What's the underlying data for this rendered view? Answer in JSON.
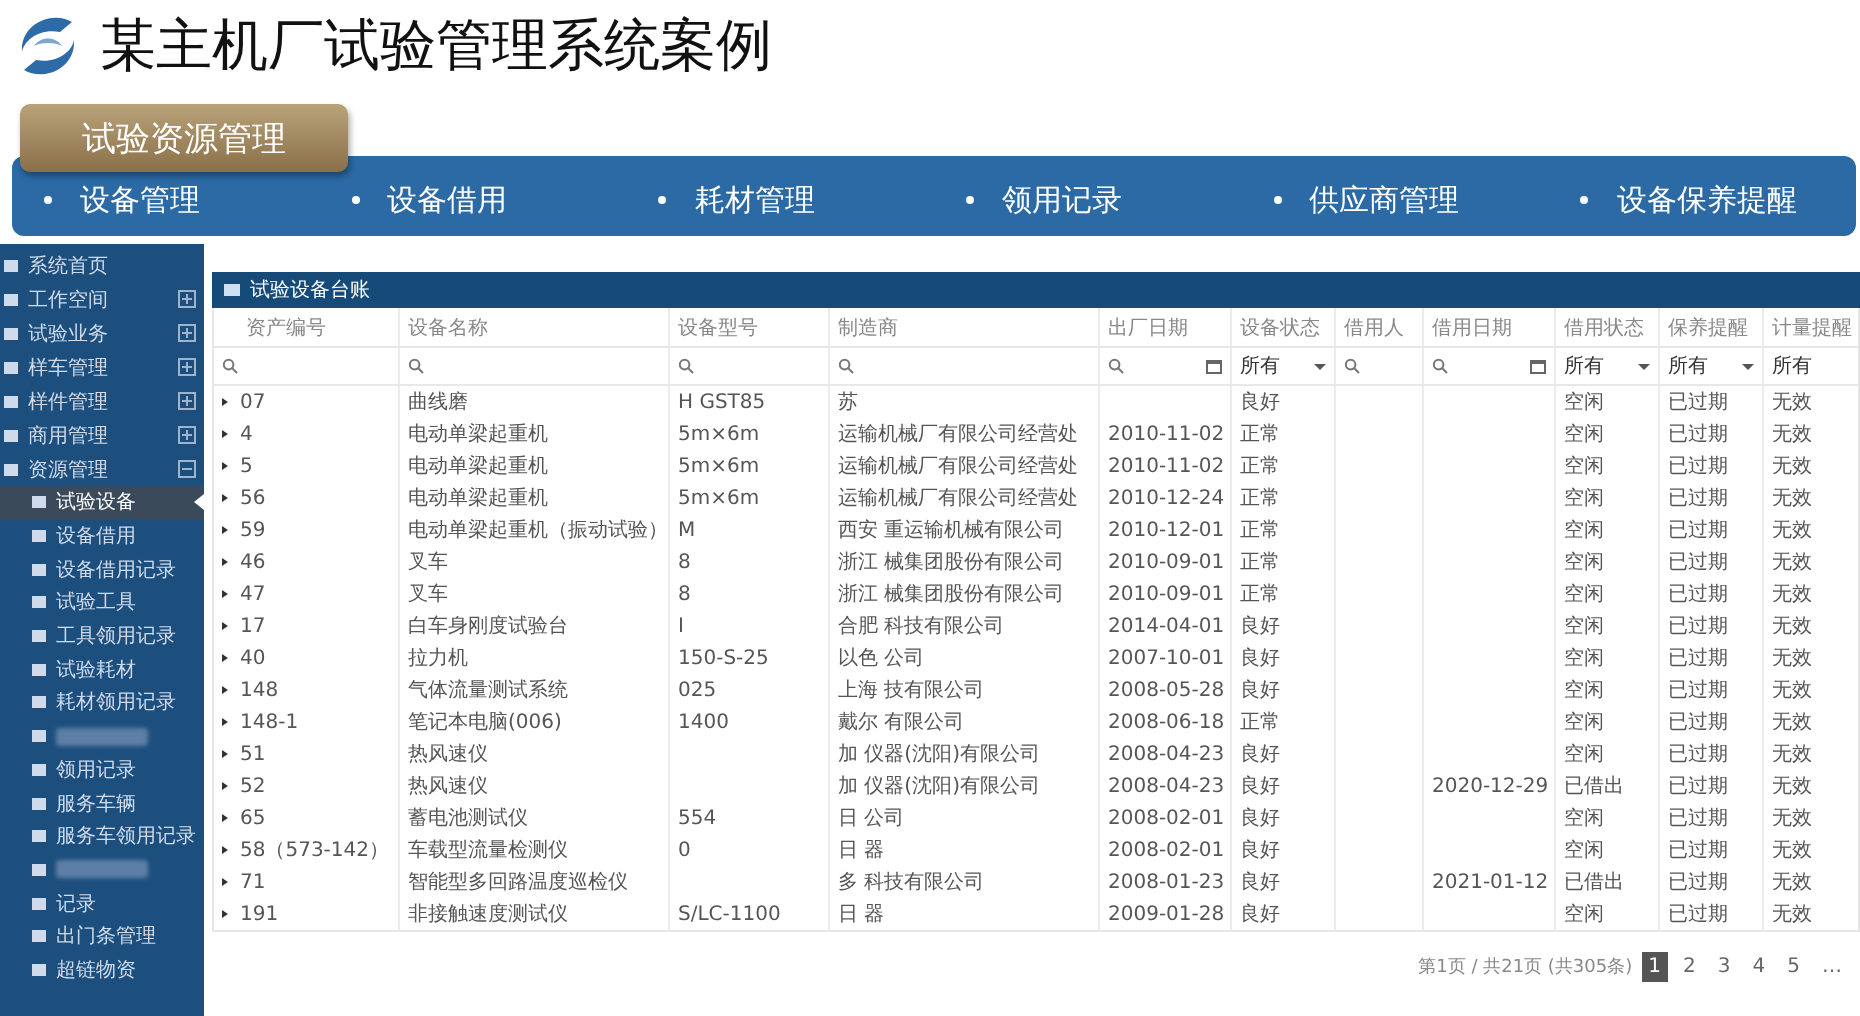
{
  "slide_title": "某主机厂试验管理系统案例",
  "section_tab": "试验资源管理",
  "nav": [
    "设备管理",
    "设备借用",
    "耗材管理",
    "领用记录",
    "供应商管理",
    "设备保养提醒"
  ],
  "sidebar": {
    "items": [
      {
        "label": "系统首页"
      },
      {
        "label": "工作空间",
        "expanded": false
      },
      {
        "label": "试验业务",
        "expanded": false
      },
      {
        "label": "样车管理",
        "expanded": false
      },
      {
        "label": "样件管理",
        "expanded": false
      },
      {
        "label": "商用管理",
        "expanded": false
      },
      {
        "label": "资源管理",
        "expanded": true,
        "children": [
          {
            "label": "试验设备",
            "selected": true
          },
          {
            "label": "设备借用",
            "selected": false
          },
          {
            "label": "设备借用记录",
            "selected": false
          },
          {
            "label": "试验工具",
            "selected": false
          },
          {
            "label": "工具领用记录",
            "selected": false
          },
          {
            "label": "试验耗材",
            "selected": false
          },
          {
            "label": "耗材领用记录",
            "selected": false
          },
          {
            "selected": false
          },
          {
            "label": "领用记录",
            "selected": false
          },
          {
            "label": "服务车辆",
            "selected": false
          },
          {
            "label": "服务车领用记录",
            "selected": false
          },
          {
            "selected": false
          },
          {
            "label": "记录",
            "selected": false
          },
          {
            "label": "出门条管理",
            "selected": false
          },
          {
            "label": "超链物资",
            "selected": false
          }
        ]
      }
    ]
  },
  "table": {
    "title": "试验设备台账",
    "columns": [
      {
        "label": "资产编号",
        "kind": "search"
      },
      {
        "label": "设备名称",
        "kind": "search"
      },
      {
        "label": "设备型号",
        "kind": "search"
      },
      {
        "label": "制造商",
        "kind": "search"
      },
      {
        "label": "出厂日期",
        "kind": "date"
      },
      {
        "label": "设备状态",
        "kind": "select",
        "filter_value": "所有"
      },
      {
        "label": "借用人",
        "kind": "search"
      },
      {
        "label": "借用日期",
        "kind": "date"
      },
      {
        "label": "借用状态",
        "kind": "select",
        "filter_value": "所有"
      },
      {
        "label": "保养提醒",
        "kind": "select",
        "filter_value": "所有"
      },
      {
        "label": "计量提醒",
        "kind": "text",
        "filter_value": "所有"
      }
    ],
    "rows": [
      [
        "07",
        "曲线磨",
        "H GST85",
        "苏",
        null,
        "良好",
        null,
        null,
        "空闲",
        "已过期",
        "无效"
      ],
      [
        "4",
        "电动单梁起重机",
        "5m×6m",
        "运输机械厂有限公司经营处",
        "2010-11-02",
        "正常",
        null,
        null,
        "空闲",
        "已过期",
        "无效"
      ],
      [
        "5",
        "电动单梁起重机",
        "5m×6m",
        "运输机械厂有限公司经营处",
        "2010-11-02",
        "正常",
        null,
        null,
        "空闲",
        "已过期",
        "无效"
      ],
      [
        "56",
        "电动单梁起重机",
        "5m×6m",
        "运输机械厂有限公司经营处",
        "2010-12-24",
        "正常",
        null,
        null,
        "空闲",
        "已过期",
        "无效"
      ],
      [
        "59",
        "电动单梁起重机（振动试验）",
        "M",
        "西安 重运输机械有限公司",
        "2010-12-01",
        "正常",
        null,
        null,
        "空闲",
        "已过期",
        "无效"
      ],
      [
        "46",
        "叉车",
        "8",
        "浙江 械集团股份有限公司",
        "2010-09-01",
        "正常",
        null,
        null,
        "空闲",
        "已过期",
        "无效"
      ],
      [
        "47",
        "叉车",
        "8",
        "浙江 械集团股份有限公司",
        "2010-09-01",
        "正常",
        null,
        null,
        "空闲",
        "已过期",
        "无效"
      ],
      [
        "17",
        "白车身刚度试验台",
        "I",
        "合肥 科技有限公司",
        "2014-04-01",
        "良好",
        null,
        null,
        "空闲",
        "已过期",
        "无效"
      ],
      [
        "40",
        "拉力机",
        "150-S-25",
        "以色 公司",
        "2007-10-01",
        "良好",
        null,
        null,
        "空闲",
        "已过期",
        "无效"
      ],
      [
        "148",
        "气体流量测试系统",
        "025",
        "上海 技有限公司",
        "2008-05-28",
        "良好",
        null,
        null,
        "空闲",
        "已过期",
        "无效"
      ],
      [
        "148-1",
        "笔记本电脑(006)",
        "1400",
        "戴尔 有限公司",
        "2008-06-18",
        "正常",
        null,
        null,
        "空闲",
        "已过期",
        "无效"
      ],
      [
        "51",
        "热风速仪",
        null,
        "加 仪器(沈阳)有限公司",
        "2008-04-23",
        "良好",
        null,
        null,
        "空闲",
        "已过期",
        "无效"
      ],
      [
        "52",
        "热风速仪",
        null,
        "加 仪器(沈阳)有限公司",
        "2008-04-23",
        "良好",
        null,
        "2020-12-29",
        "已借出",
        "已过期",
        "无效"
      ],
      [
        "65",
        "蓄电池测试仪",
        "554",
        "日 公司",
        "2008-02-01",
        "良好",
        null,
        null,
        "空闲",
        "已过期",
        "无效"
      ],
      [
        "58（573-142）",
        "车载型流量检测仪",
        "0",
        "日 器",
        "2008-02-01",
        "良好",
        null,
        null,
        "空闲",
        "已过期",
        "无效"
      ],
      [
        "71",
        "智能型多回路温度巡检仪",
        null,
        "多 科技有限公司",
        "2008-01-23",
        "良好",
        null,
        "2021-01-12",
        "已借出",
        "已过期",
        "无效"
      ],
      [
        "191",
        "非接触速度测试仪",
        "S/LC-1100",
        "日 器",
        "2009-01-28",
        "良好",
        null,
        null,
        "空闲",
        "已过期",
        "无效"
      ]
    ]
  },
  "pagination": {
    "summary": "第1页 / 共21页 (共305条)",
    "pages": [
      {
        "label": "1",
        "selected": true
      },
      {
        "label": "2",
        "selected": false
      },
      {
        "label": "3",
        "selected": false
      },
      {
        "label": "4",
        "selected": false
      },
      {
        "label": "5",
        "selected": false
      }
    ],
    "more": "…"
  }
}
